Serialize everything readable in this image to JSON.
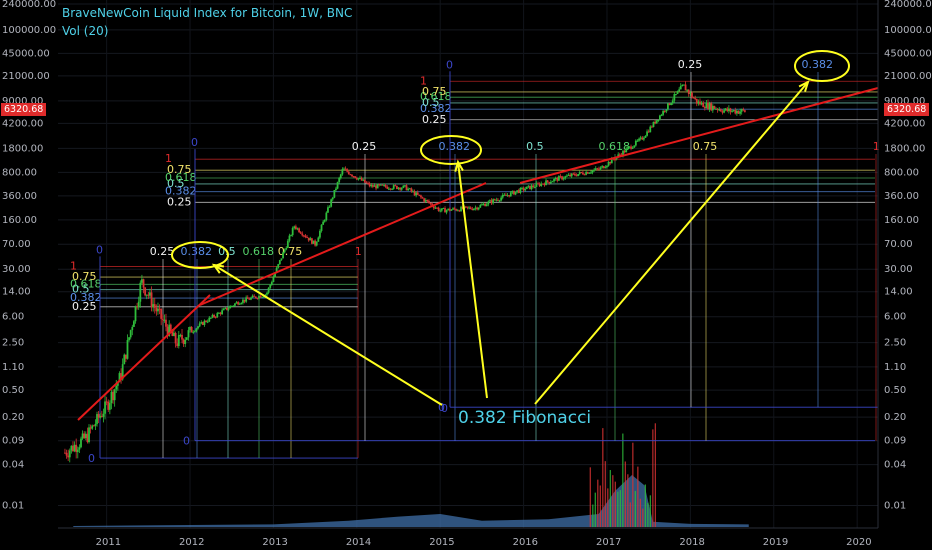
{
  "header": {
    "title": "BraveNewCoin Liquid Index for Bitcoin, 1W, BNC",
    "volume": "Vol (20)"
  },
  "annotation": {
    "text": "0.382 Fibonacci",
    "zero_label": "0"
  },
  "last_price": "6320.68",
  "colors": {
    "background": "#000000",
    "title": "#4fd1e8",
    "trendline": "#e31b1b",
    "arrows": "#ffff1f",
    "up_candle": "#2fbd3b",
    "down_candle": "#d73333",
    "volume_area": "#3f6fa8",
    "fib_0": "#3b46c8",
    "fib_025": "#f2f2f2",
    "fib_0382": "#5a8ee8",
    "fib_05": "#7fe3d0",
    "fib_0618": "#55d16a",
    "fib_075": "#f2e36b",
    "fib_1": "#e02b2b"
  },
  "chart_data": {
    "type": "line",
    "title": "BraveNewCoin Liquid Index for Bitcoin, 1W, BNC",
    "y_scale": "log",
    "ylim": [
      0.005,
      240000
    ],
    "xlim": [
      "2010-06",
      "2020-04"
    ],
    "y_ticks": [
      "240000.00",
      "100000.00",
      "45000.00",
      "21000.00",
      "9000.00",
      "4200.00",
      "1800.00",
      "800.00",
      "360.00",
      "160.00",
      "70.00",
      "30.00",
      "14.00",
      "6.00",
      "2.50",
      "1.10",
      "0.50",
      "0.20",
      "0.09",
      "0.04",
      "0.01"
    ],
    "x_ticks": [
      "2011",
      "2012",
      "2013",
      "2014",
      "2015",
      "2016",
      "2017",
      "2018",
      "2019",
      "2020"
    ],
    "series": [
      {
        "values": [
          [
            "2010-07",
            0.06
          ],
          [
            "2010-10",
            0.1
          ],
          [
            "2011-01",
            0.3
          ],
          [
            "2011-03",
            0.8
          ],
          [
            "2011-06",
            20
          ],
          [
            "2011-08",
            8
          ],
          [
            "2011-11",
            2.5
          ],
          [
            "2012-03",
            5
          ],
          [
            "2012-08",
            10
          ],
          [
            "2012-12",
            13
          ],
          [
            "2013-04",
            130
          ],
          [
            "2013-07",
            70
          ],
          [
            "2013-11",
            900
          ],
          [
            "2014-03",
            500
          ],
          [
            "2014-08",
            480
          ],
          [
            "2015-01",
            220
          ],
          [
            "2015-06",
            240
          ],
          [
            "2015-12",
            420
          ],
          [
            "2016-06",
            650
          ],
          [
            "2016-12",
            900
          ],
          [
            "2017-06",
            2500
          ],
          [
            "2017-12",
            15000
          ],
          [
            "2018-02",
            8500
          ],
          [
            "2018-06",
            6500
          ],
          [
            "2018-09",
            6320
          ]
        ]
      }
    ],
    "fib_sets": [
      {
        "levels": [
          {
            "label": "0",
            "price": 0.05
          },
          {
            "label": "0.25",
            "price": 8.4
          },
          {
            "label": "0.382",
            "price": 11.3
          },
          {
            "label": "0.5",
            "price": 15
          },
          {
            "label": "0.618",
            "price": 18
          },
          {
            "label": "0.75",
            "price": 23
          },
          {
            "label": "1",
            "price": 33
          }
        ],
        "time_labels": [
          "0.25",
          "0.382",
          "0.5",
          "0.618",
          "0.75",
          "1"
        ]
      },
      {
        "levels": [
          {
            "label": "0",
            "price": 0.09
          },
          {
            "label": "0.25",
            "price": 290
          },
          {
            "label": "0.382",
            "price": 415
          },
          {
            "label": "0.5",
            "price": 540
          },
          {
            "label": "0.618",
            "price": 660
          },
          {
            "label": "0.75",
            "price": 860
          },
          {
            "label": "1",
            "price": 1250
          }
        ],
        "time_labels": [
          "0.25",
          "0.382",
          "0.5",
          "0.618",
          "0.75",
          "1"
        ]
      },
      {
        "levels": [
          {
            "label": "0",
            "price": 0.28
          },
          {
            "label": "0.25",
            "price": 4750
          },
          {
            "label": "0.382",
            "price": 6800
          },
          {
            "label": "0.5",
            "price": 8400
          },
          {
            "label": "0.618",
            "price": 10200
          },
          {
            "label": "0.75",
            "price": 12200
          },
          {
            "label": "1",
            "price": 17500
          }
        ],
        "time_labels": [
          "0.25",
          "0.382"
        ]
      }
    ],
    "annotations": [
      "0.382 Fibonacci"
    ]
  }
}
